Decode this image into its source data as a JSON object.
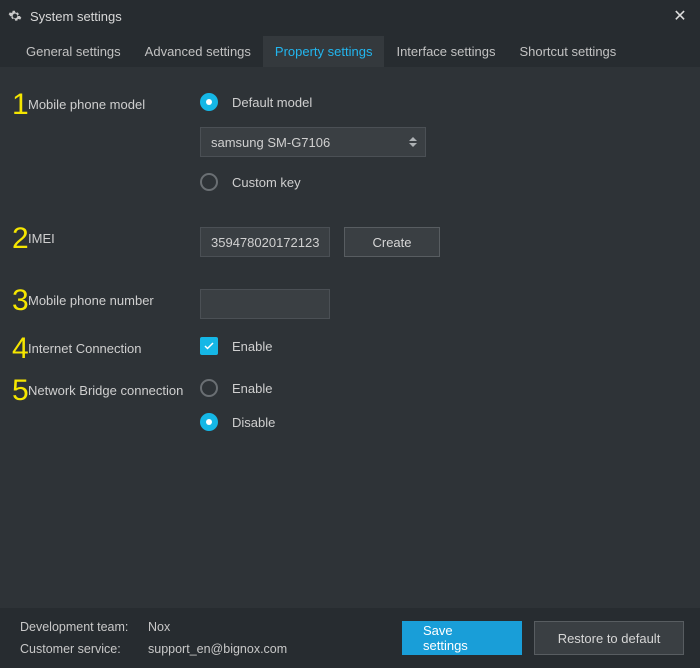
{
  "window": {
    "title": "System settings"
  },
  "tabs": {
    "general": "General settings",
    "advanced": "Advanced settings",
    "property": "Property settings",
    "interface": "Interface settings",
    "shortcut": "Shortcut settings"
  },
  "labels": {
    "phone_model": "Mobile phone model",
    "imei": "IMEI",
    "phone_number": "Mobile phone number",
    "internet": "Internet Connection",
    "bridge": "Network Bridge connection"
  },
  "model": {
    "default_label": "Default model",
    "selected_value": "samsung SM-G7106",
    "custom_label": "Custom key"
  },
  "imei": {
    "value": "359478020172123",
    "create_label": "Create"
  },
  "phone_number": {
    "value": ""
  },
  "internet": {
    "enable_label": "Enable"
  },
  "bridge": {
    "enable_label": "Enable",
    "disable_label": "Disable"
  },
  "footer": {
    "dev_team_label": "Development team:",
    "dev_team_value": "Nox",
    "support_label": "Customer service:",
    "support_value": "support_en@bignox.com",
    "save_label": "Save settings",
    "restore_label": "Restore to default"
  },
  "numbers": {
    "n1": "1",
    "n2": "2",
    "n3": "3",
    "n4": "4",
    "n5": "5"
  }
}
